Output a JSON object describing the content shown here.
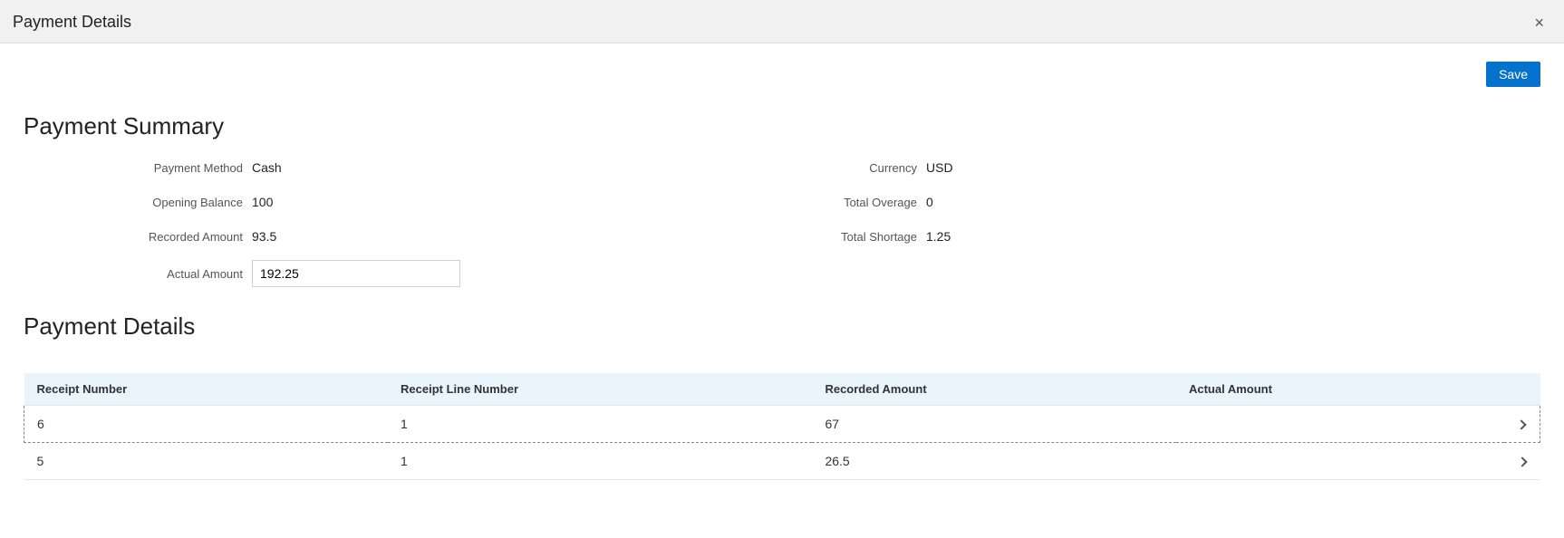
{
  "header": {
    "title": "Payment Details"
  },
  "toolbar": {
    "save_label": "Save"
  },
  "summary": {
    "title": "Payment Summary",
    "left": {
      "payment_method_label": "Payment Method",
      "payment_method_value": "Cash",
      "opening_balance_label": "Opening Balance",
      "opening_balance_value": "100",
      "recorded_amount_label": "Recorded Amount",
      "recorded_amount_value": "93.5",
      "actual_amount_label": "Actual Amount",
      "actual_amount_value": "192.25"
    },
    "right": {
      "currency_label": "Currency",
      "currency_value": "USD",
      "total_overage_label": "Total Overage",
      "total_overage_value": "0",
      "total_shortage_label": "Total Shortage",
      "total_shortage_value": "1.25"
    }
  },
  "details": {
    "title": "Payment Details",
    "columns": {
      "receipt_number": "Receipt Number",
      "receipt_line_number": "Receipt Line Number",
      "recorded_amount": "Recorded Amount",
      "actual_amount": "Actual Amount"
    },
    "rows": [
      {
        "receipt_number": "6",
        "receipt_line_number": "1",
        "recorded_amount": "67",
        "actual_amount": ""
      },
      {
        "receipt_number": "5",
        "receipt_line_number": "1",
        "recorded_amount": "26.5",
        "actual_amount": ""
      }
    ]
  }
}
